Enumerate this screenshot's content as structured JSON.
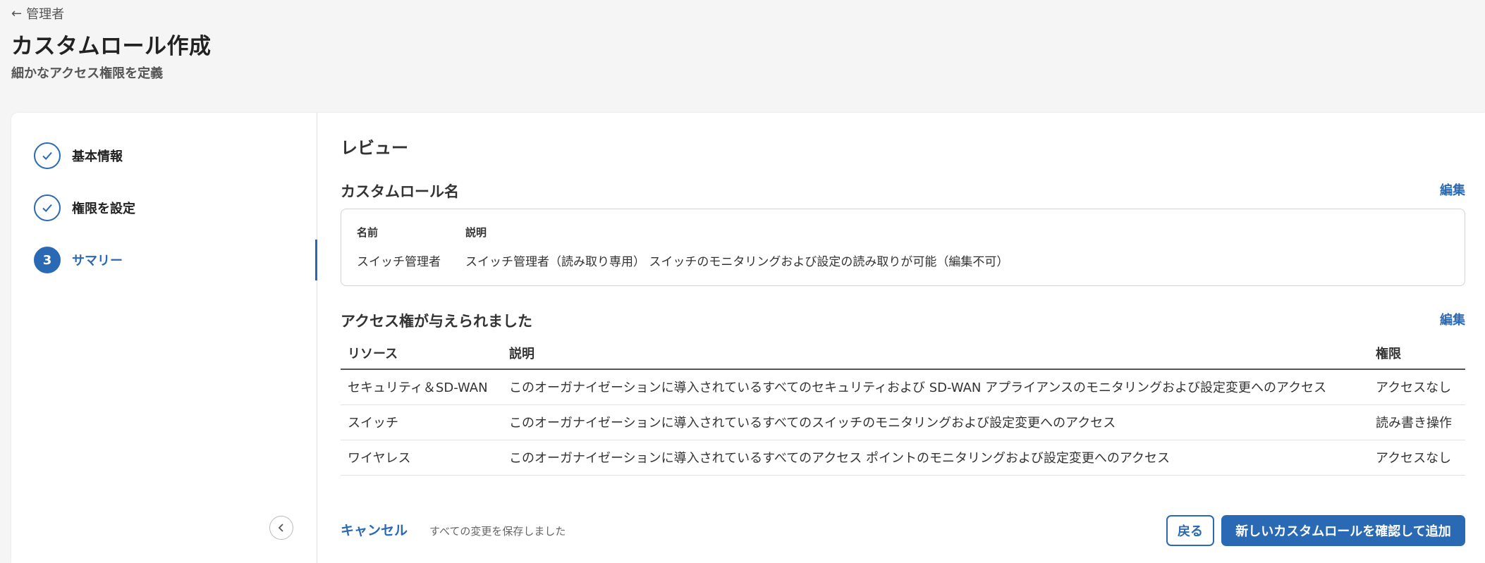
{
  "header": {
    "back_label": "管理者",
    "title": "カスタムロール作成",
    "subtitle": "細かなアクセス権限を定義"
  },
  "steps": [
    {
      "number": "1",
      "label": "基本情報",
      "status": "done"
    },
    {
      "number": "2",
      "label": "権限を設定",
      "status": "done"
    },
    {
      "number": "3",
      "label": "サマリー",
      "status": "active"
    }
  ],
  "review": {
    "title": "レビュー",
    "role_section": {
      "title": "カスタムロール名",
      "edit_label": "編集",
      "name_header": "名前",
      "desc_header": "説明",
      "name_value": "スイッチ管理者",
      "desc_value": "スイッチ管理者（読み取り専用） スイッチのモニタリングおよび設定の読み取りが可能（編集不可）"
    },
    "access_section": {
      "title": "アクセス権が与えられました",
      "edit_label": "編集",
      "columns": [
        "リソース",
        "説明",
        "権限"
      ],
      "rows": [
        {
          "resource": "セキュリティ＆SD-WAN",
          "description": "このオーガナイゼーションに導入されているすべてのセキュリティおよび SD-WAN アプライアンスのモニタリングおよび設定変更へのアクセス",
          "permission": "アクセスなし"
        },
        {
          "resource": "スイッチ",
          "description": "このオーガナイゼーションに導入されているすべてのスイッチのモニタリングおよび設定変更へのアクセス",
          "permission": "読み書き操作"
        },
        {
          "resource": "ワイヤレス",
          "description": "このオーガナイゼーションに導入されているすべてのアクセス ポイントのモニタリングおよび設定変更へのアクセス",
          "permission": "アクセスなし"
        }
      ]
    }
  },
  "footer": {
    "cancel_label": "キャンセル",
    "saved_text": "すべての変更を保存しました",
    "back_label": "戻る",
    "confirm_label": "新しいカスタムロールを確認して追加"
  },
  "colors": {
    "accent": "#2a6ab5"
  }
}
